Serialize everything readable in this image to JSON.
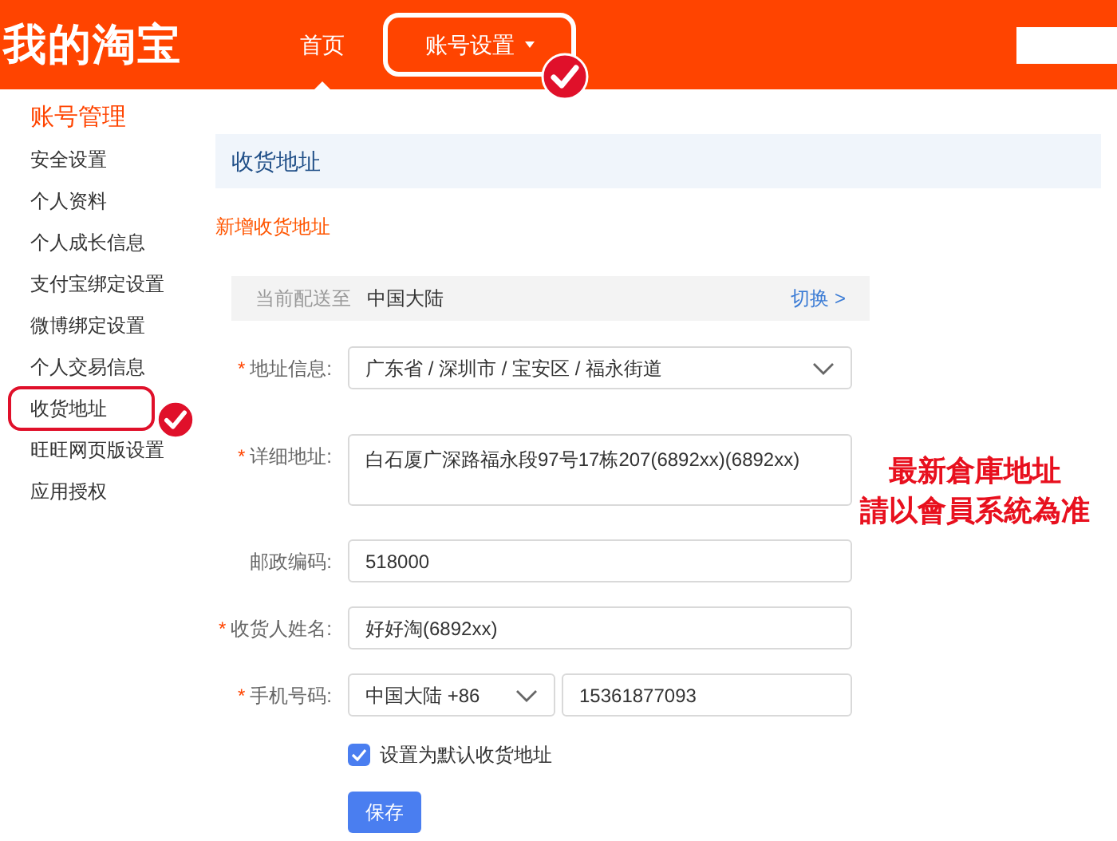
{
  "header": {
    "logo": "我的淘宝",
    "nav": [
      {
        "label": "首页",
        "selected": true,
        "dropdown": false,
        "annotated": false
      },
      {
        "label": "账号设置",
        "selected": false,
        "dropdown": true,
        "annotated": true
      }
    ]
  },
  "sidebar": {
    "title": "账号管理",
    "items": [
      {
        "label": "安全设置",
        "annotated": false
      },
      {
        "label": "个人资料",
        "annotated": false
      },
      {
        "label": "个人成长信息",
        "annotated": false
      },
      {
        "label": "支付宝绑定设置",
        "annotated": false
      },
      {
        "label": "微博绑定设置",
        "annotated": false
      },
      {
        "label": "个人交易信息",
        "annotated": false
      },
      {
        "label": "收货地址",
        "annotated": true
      },
      {
        "label": "旺旺网页版设置",
        "annotated": false
      },
      {
        "label": "应用授权",
        "annotated": false
      }
    ]
  },
  "section_title": "收货地址",
  "add_link": "新增收货地址",
  "region_bar": {
    "label": "当前配送至",
    "value": "中国大陆",
    "action": "切换 >"
  },
  "fields": [
    {
      "kind": "select",
      "label": "地址信息:",
      "required_mark": "*",
      "value": "广东省 / 深圳市 / 宝安区 / 福永街道"
    },
    {
      "kind": "textarea",
      "label": "详细地址:",
      "required_mark": "*",
      "value": "白石厦广深路福永段97号17栋207(6892xx)(6892xx)"
    },
    {
      "kind": "input",
      "label": "邮政编码:",
      "value": "518000"
    },
    {
      "kind": "input",
      "label": "收货人姓名:",
      "required_mark": "*",
      "value": "好好淘(6892xx)"
    },
    {
      "kind": "phone",
      "label": "手机号码:",
      "required_mark": "*",
      "code": "中国大陆 +86",
      "value": "15361877093"
    }
  ],
  "default_checkbox": {
    "label": "设置为默认收货地址",
    "checked": true
  },
  "save_button": "保存",
  "annotation": [
    "最新倉庫地址",
    "請以會員系統為准"
  ]
}
